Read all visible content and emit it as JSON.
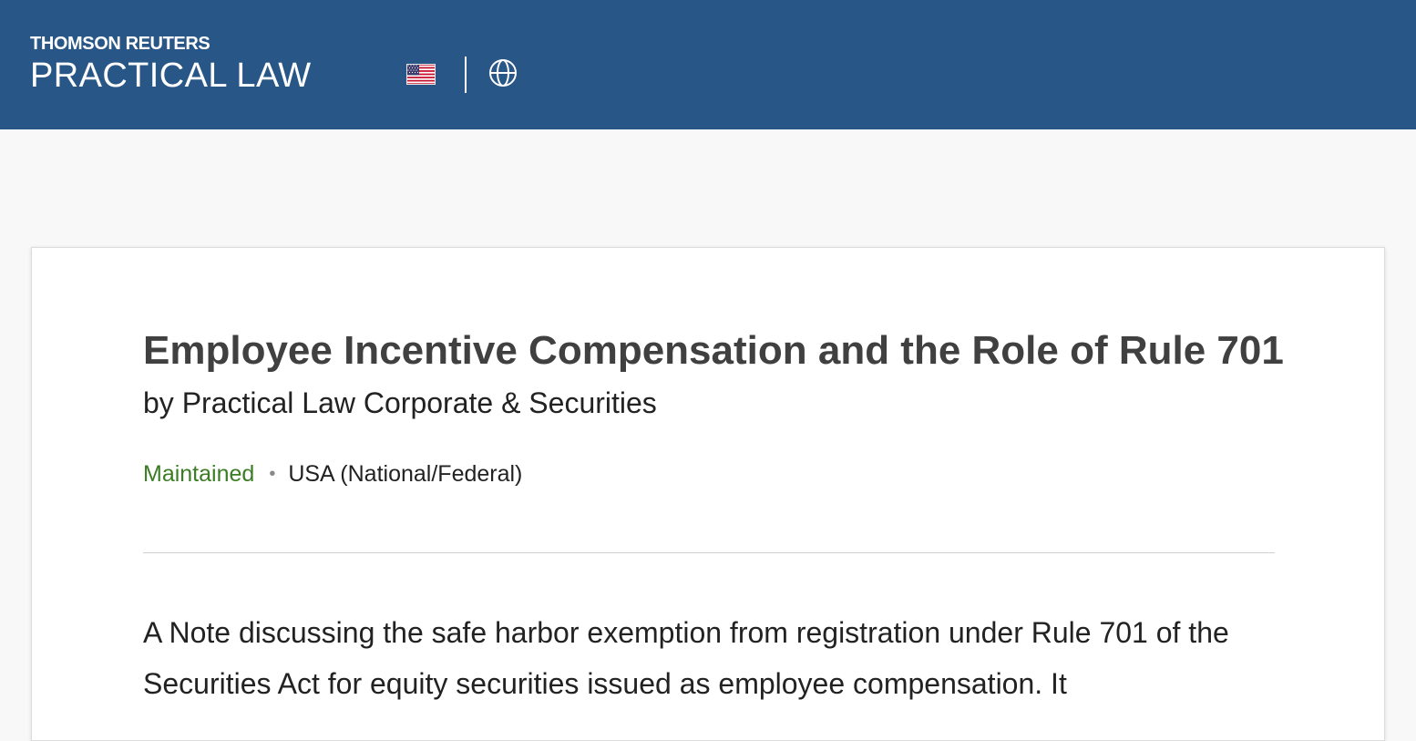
{
  "header": {
    "brand_top": "THOMSON REUTERS",
    "brand_bottom": "PRACTICAL LAW",
    "region_icon": "us-flag-icon",
    "language_icon": "globe-icon",
    "background_color": "#275687"
  },
  "document": {
    "title": "Employee Incentive Compensation and the Role of Rule 701",
    "byline": "by Practical Law Corporate & Securities",
    "status": "Maintained",
    "status_color": "#3b7d23",
    "jurisdiction": "USA (National/Federal)",
    "abstract": "A Note discussing the safe harbor exemption from registration under Rule 701 of the Securities Act for equity securities issued as employee compensation. It"
  }
}
